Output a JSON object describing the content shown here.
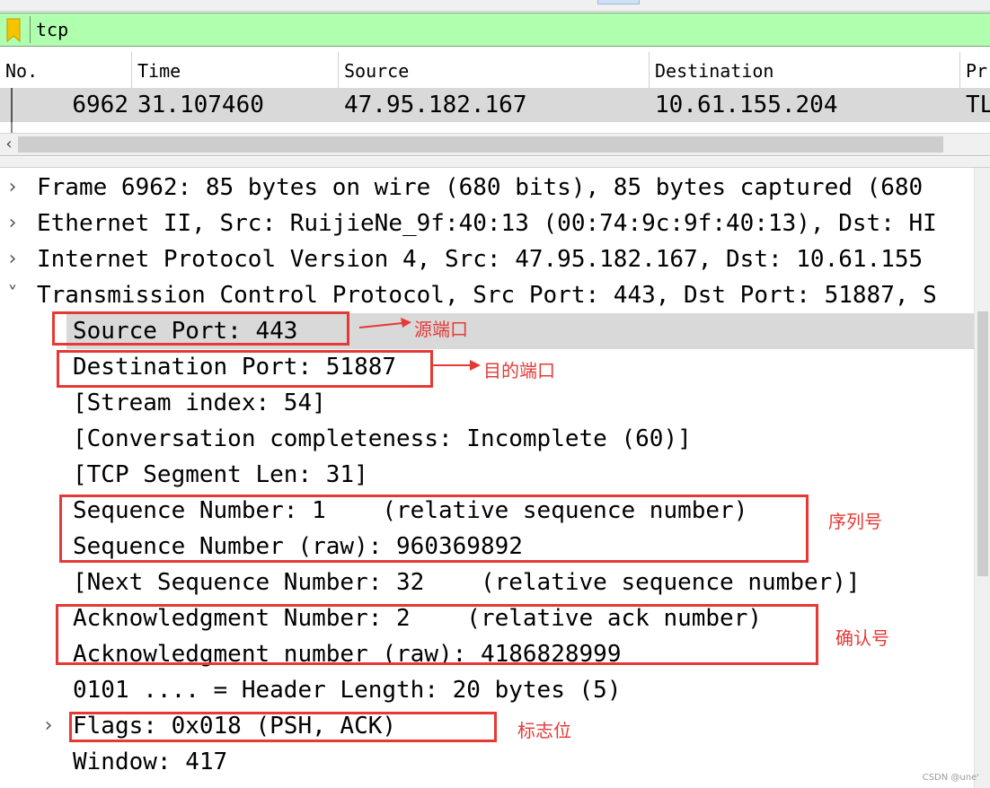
{
  "filter": {
    "value": "tcp"
  },
  "columns": [
    "No.",
    "Time",
    "Source",
    "Destination",
    "Pr"
  ],
  "packet": {
    "no": "6962",
    "time": "31.107460",
    "source": "47.95.182.167",
    "destination": "10.61.155.204",
    "protocol": "TL"
  },
  "tree": [
    {
      "expander": "›",
      "text": "Frame 6962: 85 bytes on wire (680 bits), 85 bytes captured (680"
    },
    {
      "expander": "›",
      "text": "Ethernet II, Src: RuijieNe_9f:40:13 (00:74:9c:9f:40:13), Dst: HI"
    },
    {
      "expander": "›",
      "text": "Internet Protocol Version 4, Src: 47.95.182.167, Dst: 10.61.155"
    },
    {
      "expander": "˅",
      "text": "Transmission Control Protocol, Src Port: 443, Dst Port: 51887, S"
    },
    {
      "expander": "",
      "text": "Source Port: 443"
    },
    {
      "expander": "",
      "text": "Destination Port: 51887"
    },
    {
      "expander": "",
      "text": "[Stream index: 54]"
    },
    {
      "expander": "",
      "text": "[Conversation completeness: Incomplete (60)]"
    },
    {
      "expander": "",
      "text": "[TCP Segment Len: 31]"
    },
    {
      "expander": "",
      "text": "Sequence Number: 1    (relative sequence number)"
    },
    {
      "expander": "",
      "text": "Sequence Number (raw): 960369892"
    },
    {
      "expander": "",
      "text": "[Next Sequence Number: 32    (relative sequence number)]"
    },
    {
      "expander": "",
      "text": "Acknowledgment Number: 2    (relative ack number)"
    },
    {
      "expander": "",
      "text": "Acknowledgment number (raw): 4186828999"
    },
    {
      "expander": "",
      "text": "0101 .... = Header Length: 20 bytes (5)"
    },
    {
      "expander": "›",
      "text": "Flags: 0x018 (PSH, ACK)"
    },
    {
      "expander": "",
      "text": "Window: 417"
    }
  ],
  "annotations": {
    "source_port": "源端口",
    "destination_port": "目的端口",
    "sequence": "序列号",
    "ack": "确认号",
    "flags": "标志位"
  },
  "annotation_color": "#e53935",
  "filter_bg_color": "#afffaf",
  "watermark": "CSDN @une'"
}
